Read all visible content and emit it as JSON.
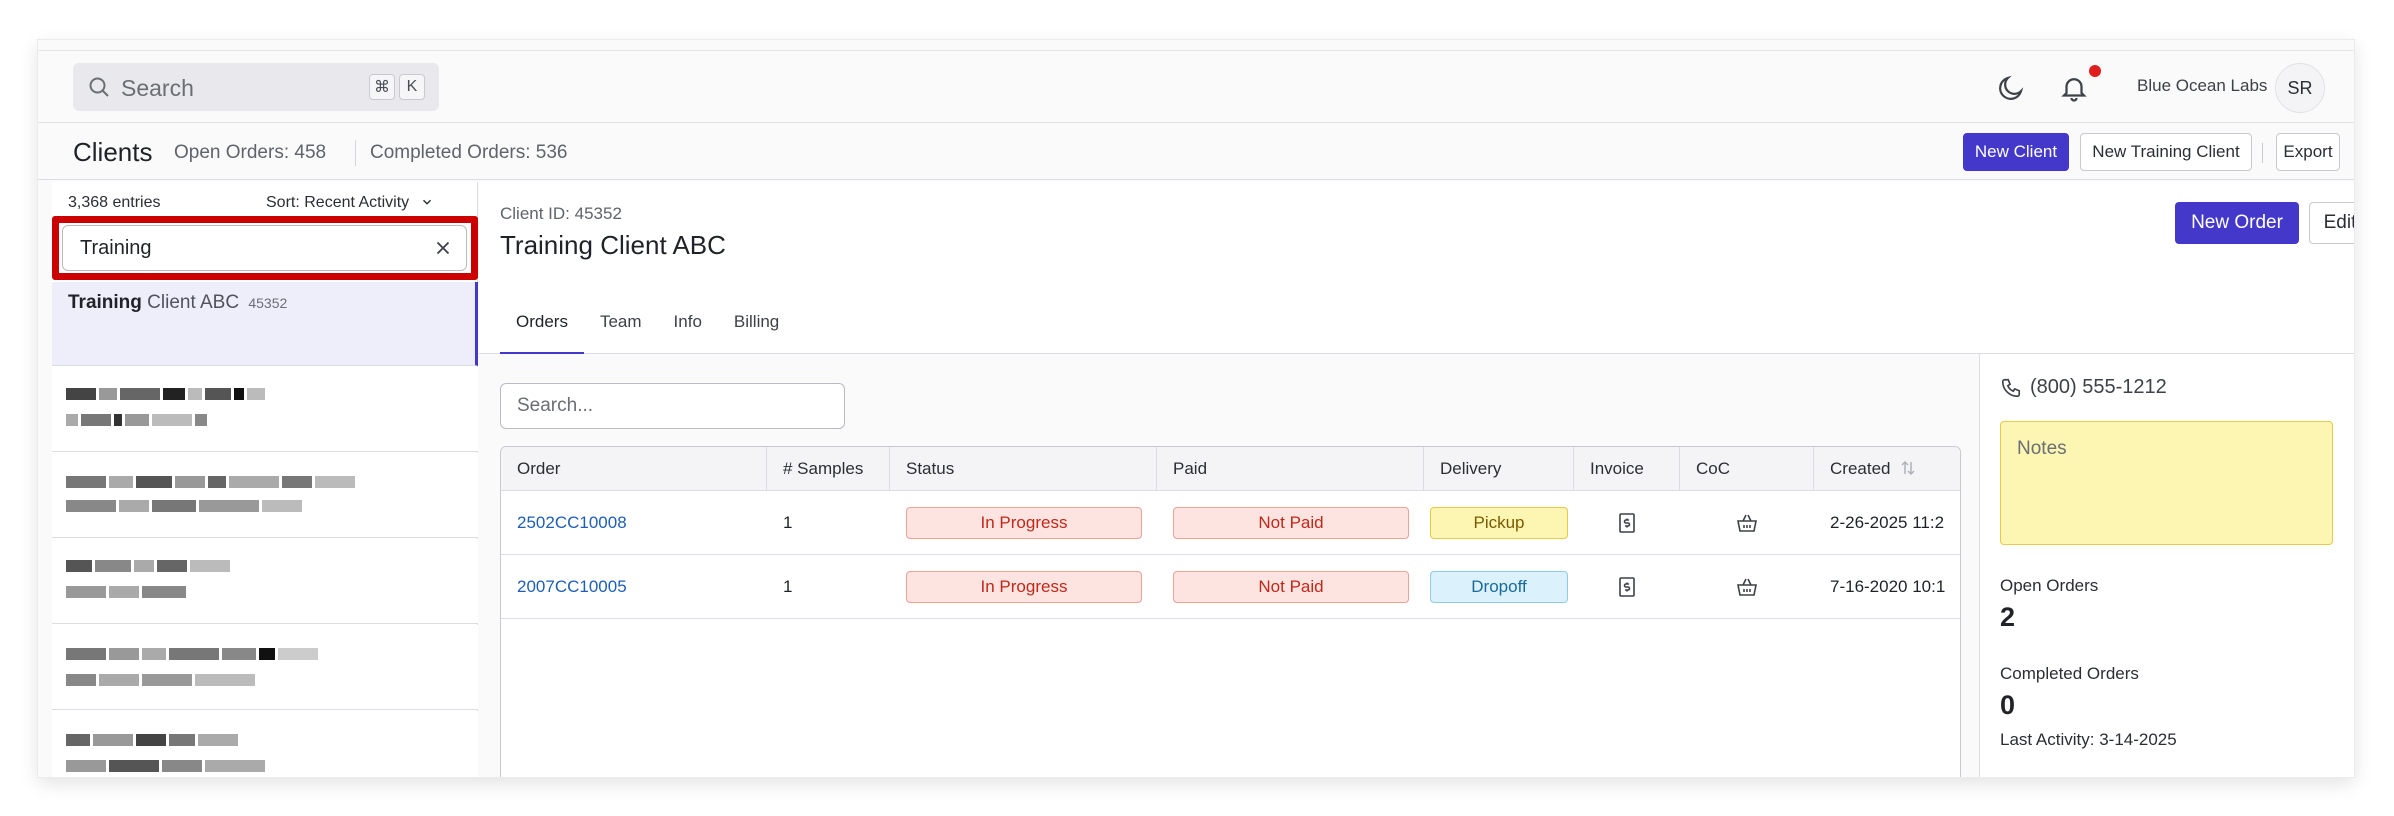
{
  "topbar": {
    "search_placeholder": "Search",
    "kbd_cmd": "⌘",
    "kbd_k": "K",
    "org_name": "Blue Ocean Labs",
    "avatar_initials": "SR"
  },
  "subheader": {
    "title": "Clients",
    "open_orders": "Open Orders: 458",
    "completed_orders": "Completed Orders: 536",
    "new_client": "New Client",
    "new_training_client": "New Training Client",
    "export": "Export"
  },
  "sidebar": {
    "entries": "3,368 entries",
    "sort": "Sort: Recent Activity",
    "filter_value": "Training",
    "selected": {
      "match": "Training",
      "rest": " Client ABC",
      "id": "45352"
    }
  },
  "client": {
    "id_label": "Client ID: 45352",
    "name": "Training Client ABC",
    "new_order": "New Order",
    "edit": "Edit",
    "tabs": [
      "Orders",
      "Team",
      "Info",
      "Billing"
    ]
  },
  "orders": {
    "search_placeholder": "Search...",
    "columns": [
      "Order",
      "# Samples",
      "Status",
      "Paid",
      "Delivery",
      "Invoice",
      "CoC",
      "Created"
    ],
    "rows": [
      {
        "order": "2502CC10008",
        "samples": "1",
        "status": "In Progress",
        "paid": "Not Paid",
        "delivery": "Pickup",
        "created": "2-26-2025 11:2"
      },
      {
        "order": "2007CC10005",
        "samples": "1",
        "status": "In Progress",
        "paid": "Not Paid",
        "delivery": "Dropoff",
        "created": "7-16-2020 10:1"
      }
    ]
  },
  "side": {
    "phone": "(800) 555-1212",
    "notes_placeholder": "Notes",
    "open_orders_label": "Open Orders",
    "open_orders_value": "2",
    "completed_orders_label": "Completed Orders",
    "completed_orders_value": "0",
    "last_activity": "Last Activity: 3-14-2025"
  },
  "colors": {
    "accent": "#4338ca",
    "highlight_box": "#cc0000",
    "selected_row": "#eeeefb"
  }
}
